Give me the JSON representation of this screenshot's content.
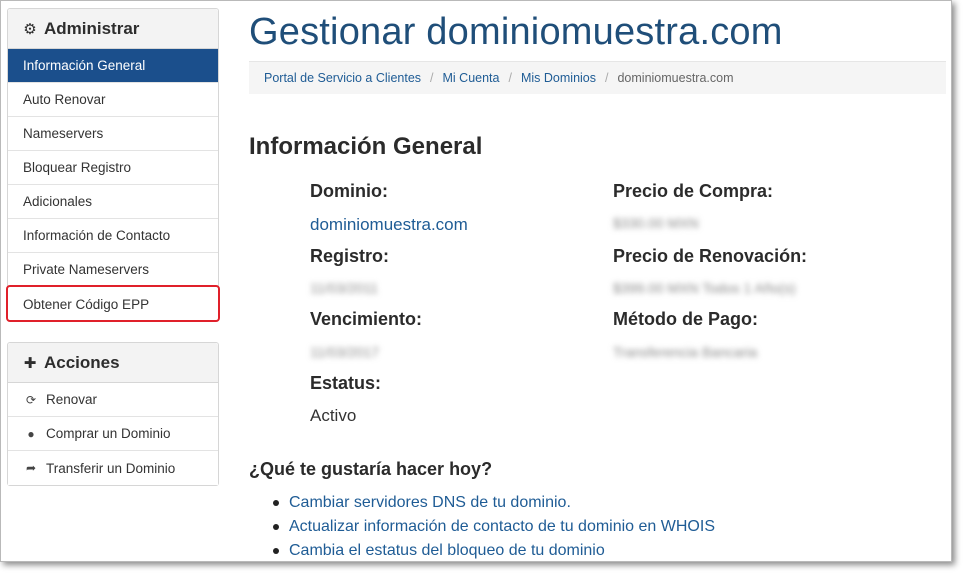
{
  "sidebar": {
    "manage": {
      "title": "Administrar",
      "icon": "gear-icon",
      "items": [
        {
          "label": "Información General",
          "active": true
        },
        {
          "label": "Auto Renovar"
        },
        {
          "label": "Nameservers"
        },
        {
          "label": "Bloquear Registro"
        },
        {
          "label": "Adicionales"
        },
        {
          "label": "Información de Contacto"
        },
        {
          "label": "Private Nameservers"
        },
        {
          "label": "Obtener Código EPP",
          "highlighted": true
        }
      ]
    },
    "actions": {
      "title": "Acciones",
      "icon": "plus-icon",
      "items": [
        {
          "label": "Renovar",
          "icon": "refresh-icon"
        },
        {
          "label": "Comprar un Dominio",
          "icon": "globe-icon"
        },
        {
          "label": "Transferir un Dominio",
          "icon": "share-arrow-icon"
        }
      ]
    }
  },
  "main": {
    "title": "Gestionar dominiomuestra.com",
    "breadcrumb": [
      "Portal de Servicio a Clientes",
      "Mi Cuenta",
      "Mis Dominios",
      "dominiomuestra.com"
    ],
    "section_title": "Información General",
    "fields": {
      "domain_label": "Dominio:",
      "domain_value": "dominiomuestra.com",
      "registration_label": "Registro:",
      "registration_value": "11/03/2011",
      "expiry_label": "Vencimiento:",
      "expiry_value": "11/03/2017",
      "status_label": "Estatus:",
      "status_value": "Activo",
      "purchase_price_label": "Precio de Compra:",
      "purchase_price_value": "$330.00 MXN",
      "renewal_price_label": "Precio de Renovación:",
      "renewal_price_value": "$399.00 MXN Todos 1 Año(s)",
      "payment_method_label": "Método de Pago:",
      "payment_method_value": "Transferencia Bancaria"
    },
    "question": "¿Qué te gustaría hacer hoy?",
    "links": [
      "Cambiar servidores DNS de tu dominio.",
      "Actualizar información de contacto de tu dominio en WHOIS",
      "Cambia el estatus del bloqueo de tu dominio"
    ]
  },
  "colors": {
    "active_item_bg": "#1b4f8c",
    "title": "#1f4e79",
    "link": "#1f5c95",
    "highlight_border": "#e0202a"
  }
}
